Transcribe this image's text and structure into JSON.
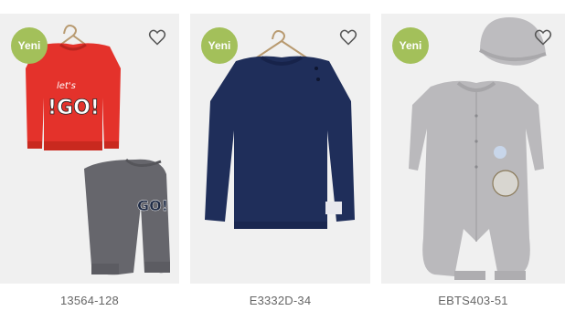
{
  "products": [
    {
      "badge": "Yeni",
      "code": "13564-128",
      "print_top": "let's",
      "print_main": "!GO!",
      "print_pants": "GO!"
    },
    {
      "badge": "Yeni",
      "code": "E3332D-34"
    },
    {
      "badge": "Yeni",
      "code": "EBTS403-51"
    }
  ],
  "colors": {
    "badge": "#a3c05a",
    "card_bg": "#f0f0f0",
    "code_text": "#666666"
  },
  "icons": [
    "heart-icon",
    "hanger-icon"
  ]
}
